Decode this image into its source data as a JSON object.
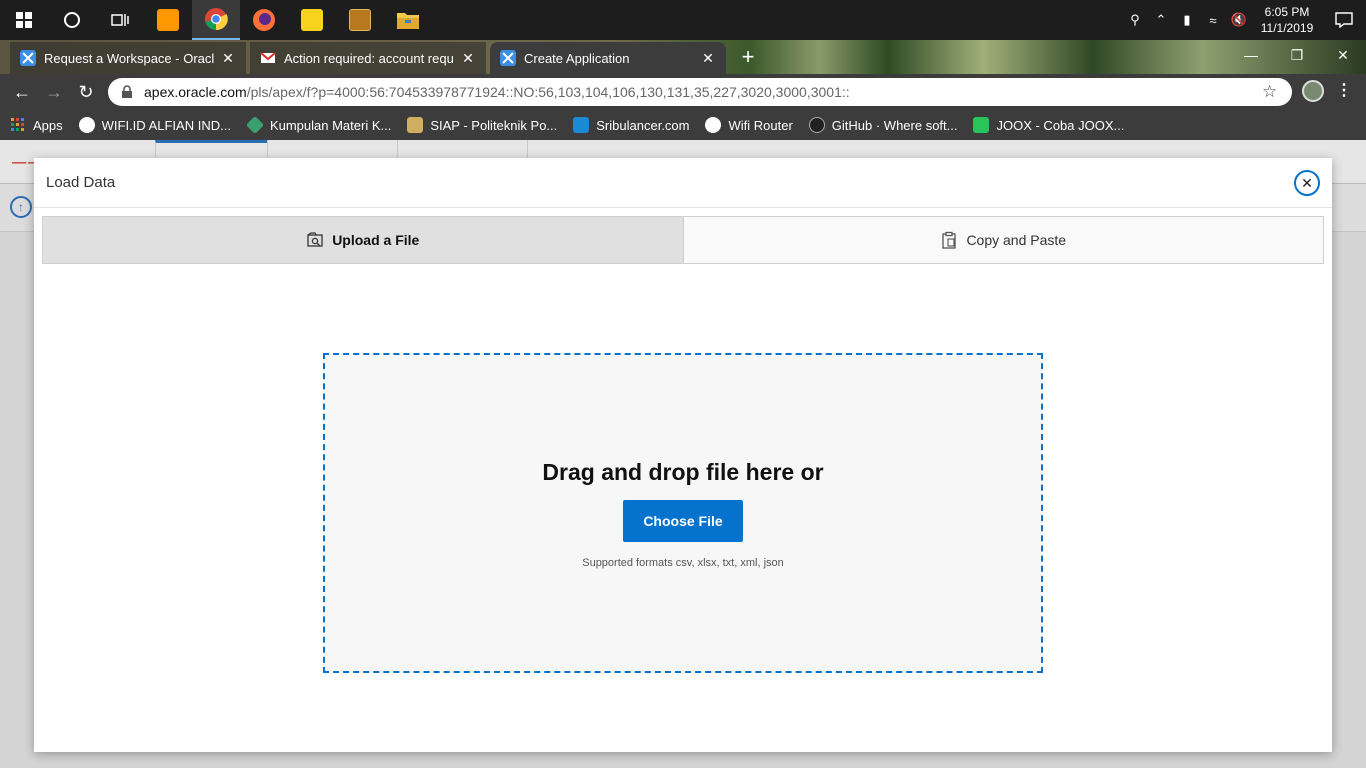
{
  "taskbar": {
    "clock_time": "6:05 PM",
    "clock_date": "11/1/2019",
    "apps": [
      {
        "name": "start-button"
      },
      {
        "name": "cortana-button"
      },
      {
        "name": "task-view-button"
      },
      {
        "name": "sublime-text"
      },
      {
        "name": "chrome"
      },
      {
        "name": "firefox"
      },
      {
        "name": "sticky-notes"
      },
      {
        "name": "dosbox"
      },
      {
        "name": "file-explorer"
      }
    ]
  },
  "browser": {
    "tabs": [
      {
        "title": "Request a Workspace - Oracle Ap",
        "active": false
      },
      {
        "title": "Action required: account request",
        "active": false
      },
      {
        "title": "Create Application",
        "active": true
      }
    ],
    "url_host": "apex.oracle.com",
    "url_path": "/pls/apex/f?p=4000:56:704533978771924::NO:56,103,104,106,130,131,35,227,3020,3000,3001::",
    "bookmarks": [
      {
        "label": "Apps",
        "color": "#e0a030"
      },
      {
        "label": "WIFI.ID ALFIAN IND...",
        "color": "#ffffff"
      },
      {
        "label": "Kumpulan Materi K...",
        "color": "#3aa070"
      },
      {
        "label": "SIAP - Politeknik Po...",
        "color": "#d0b060"
      },
      {
        "label": "Sribulancer.com",
        "color": "#1a8ad4"
      },
      {
        "label": "Wifi Router",
        "color": "#ffffff"
      },
      {
        "label": "GitHub · Where soft...",
        "color": "#222222"
      },
      {
        "label": "JOOX - Coba JOOX...",
        "color": "#29c45a"
      }
    ]
  },
  "dialog": {
    "title": "Load Data",
    "tabs": [
      {
        "label": "Upload a File",
        "icon": "upload-file-icon",
        "selected": true
      },
      {
        "label": "Copy and Paste",
        "icon": "clipboard-icon",
        "selected": false
      }
    ],
    "dropzone": {
      "heading": "Drag and drop file here or",
      "button_label": "Choose File",
      "formats": "Supported formats csv, xlsx, txt, xml, json"
    }
  },
  "colors": {
    "accent": "#0572ce",
    "oracle_red": "#c74634"
  }
}
